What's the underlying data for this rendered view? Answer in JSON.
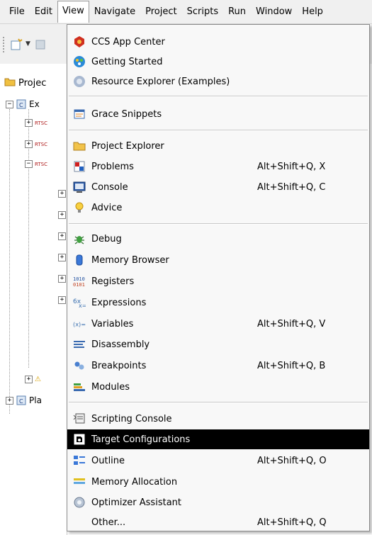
{
  "menubar": {
    "items": [
      "File",
      "Edit",
      "View",
      "Navigate",
      "Project",
      "Scripts",
      "Run",
      "Window",
      "Help"
    ],
    "active": "View"
  },
  "explorer": {
    "title": "Projec",
    "tree": [
      {
        "label": "Ex"
      },
      {
        "label": "Pla"
      }
    ]
  },
  "menu": {
    "items": [
      {
        "label": "CCS App Center",
        "icon": "app-center-icon"
      },
      {
        "label": "Getting Started",
        "icon": "getting-started-icon"
      },
      {
        "label": "Resource Explorer (Examples)",
        "icon": "resource-explorer-icon"
      },
      {
        "label": "Grace Snippets",
        "icon": "snippets-icon"
      },
      {
        "label": "Project Explorer",
        "icon": "folder-icon"
      },
      {
        "label": "Problems",
        "shortcut": "Alt+Shift+Q, X",
        "icon": "problems-icon"
      },
      {
        "label": "Console",
        "shortcut": "Alt+Shift+Q, C",
        "icon": "console-icon"
      },
      {
        "label": "Advice",
        "icon": "lightbulb-icon"
      },
      {
        "label": "Debug",
        "icon": "bug-icon"
      },
      {
        "label": "Memory Browser",
        "icon": "memory-icon"
      },
      {
        "label": "Registers",
        "icon": "registers-icon"
      },
      {
        "label": "Expressions",
        "icon": "expressions-icon"
      },
      {
        "label": "Variables",
        "shortcut": "Alt+Shift+Q, V",
        "icon": "variables-icon"
      },
      {
        "label": "Disassembly",
        "icon": "disassembly-icon"
      },
      {
        "label": "Breakpoints",
        "shortcut": "Alt+Shift+Q, B",
        "icon": "breakpoints-icon"
      },
      {
        "label": "Modules",
        "icon": "modules-icon"
      },
      {
        "label": "Scripting Console",
        "icon": "scripting-console-icon"
      },
      {
        "label": "Target Configurations",
        "icon": "target-config-icon"
      },
      {
        "label": "Outline",
        "shortcut": "Alt+Shift+Q, O",
        "icon": "outline-icon"
      },
      {
        "label": "Memory Allocation",
        "icon": "memory-allocation-icon"
      },
      {
        "label": "Optimizer Assistant",
        "icon": "optimizer-icon"
      },
      {
        "label": "Other...",
        "shortcut": "Alt+Shift+Q, Q",
        "icon": ""
      }
    ],
    "highlighted_index": 17
  },
  "colors": {
    "highlight_bg": "#000000",
    "menu_bg": "#f8f8f8",
    "menubar_bg": "#f0f0f0"
  }
}
